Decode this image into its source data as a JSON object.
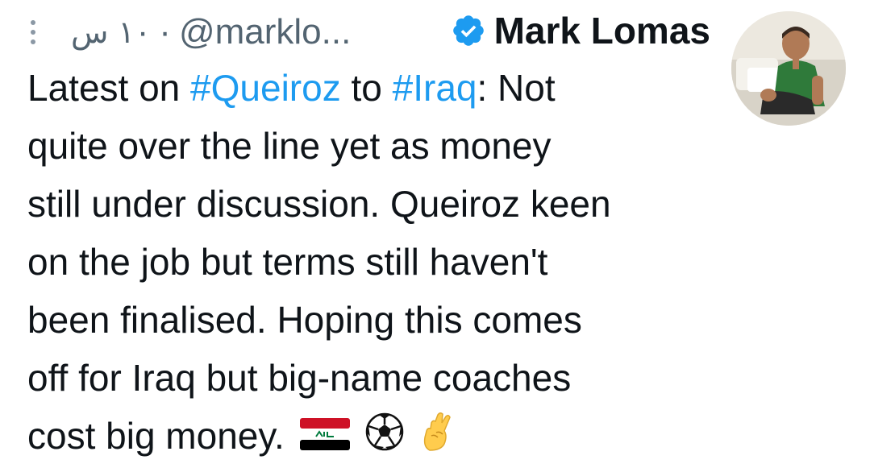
{
  "tweet": {
    "author": {
      "display_name": "Mark Lomas",
      "handle": "@marklo...",
      "verified": true
    },
    "time": "١٠ س",
    "separator": "·",
    "text_lines": [
      {
        "parts": [
          {
            "type": "text",
            "value": "Latest on "
          },
          {
            "type": "hashtag",
            "value": "#Queiroz"
          },
          {
            "type": "text",
            "value": " to "
          },
          {
            "type": "hashtag",
            "value": "#Iraq"
          },
          {
            "type": "text",
            "value": ": Not"
          }
        ]
      },
      {
        "parts": [
          {
            "type": "text",
            "value": "quite over the line yet as money"
          }
        ]
      },
      {
        "parts": [
          {
            "type": "text",
            "value": "still under discussion. Queiroz keen"
          }
        ]
      },
      {
        "parts": [
          {
            "type": "text",
            "value": "on the job but terms still haven't"
          }
        ]
      },
      {
        "parts": [
          {
            "type": "text",
            "value": "been finalised. Hoping this comes"
          }
        ]
      },
      {
        "parts": [
          {
            "type": "text",
            "value": "off for Iraq but big-name coaches"
          }
        ]
      },
      {
        "parts": [
          {
            "type": "text",
            "value": "cost big money."
          }
        ]
      }
    ],
    "emojis": [
      "iraq-flag-icon",
      "soccer-ball-icon",
      "crossed-fingers-icon"
    ],
    "colors": {
      "hashtag": "#1d9bf0",
      "text": "#0f1419",
      "meta": "#536471",
      "verified": "#1d9bf0"
    }
  }
}
